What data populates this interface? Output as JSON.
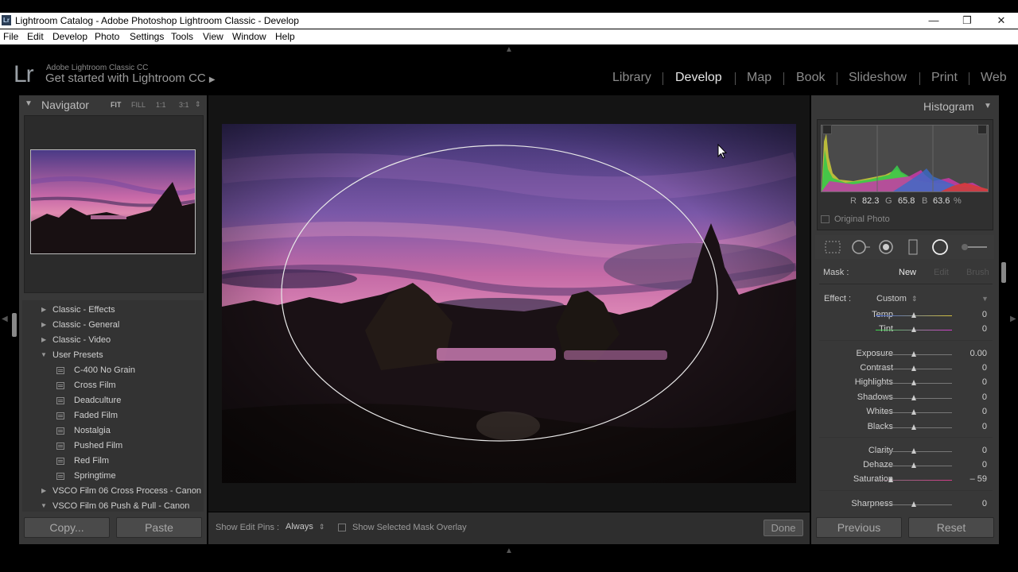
{
  "window": {
    "title": "Lightroom Catalog - Adobe Photoshop Lightroom Classic - Develop",
    "app_icon": "Lr",
    "controls": {
      "minimize": "—",
      "restore": "❐",
      "close": "✕"
    }
  },
  "menu": [
    "File",
    "Edit",
    "Develop",
    "Photo",
    "Settings",
    "Tools",
    "View",
    "Window",
    "Help"
  ],
  "identity": {
    "logo": "Lr",
    "product": "Adobe Lightroom Classic CC",
    "tagline": "Get started with Lightroom CC",
    "tagline_arrow": "▶"
  },
  "modules": [
    "Library",
    "Develop",
    "Map",
    "Book",
    "Slideshow",
    "Print",
    "Web"
  ],
  "active_module": "Develop",
  "navigator": {
    "title": "Navigator",
    "zoom_options": [
      "FIT",
      "FILL",
      "1:1",
      "3:1"
    ],
    "selected_zoom": "FIT",
    "collapse_icon": "▼",
    "zoom_menu_icon": "⇕"
  },
  "presets": {
    "groups": [
      {
        "label": "Classic - Effects",
        "expanded": false
      },
      {
        "label": "Classic - General",
        "expanded": false
      },
      {
        "label": "Classic - Video",
        "expanded": false
      },
      {
        "label": "User Presets",
        "expanded": true
      }
    ],
    "user_presets": [
      "C-400 No Grain",
      "Cross Film",
      "Deadculture",
      "Faded Film",
      "Nostalgia",
      "Pushed Film",
      "Red Film",
      "Springtime"
    ],
    "vsco": [
      {
        "label": "VSCO Film 06 Cross Process - Canon",
        "expanded": false
      },
      {
        "label": "VSCO Film 06 Push & Pull - Canon",
        "expanded": true
      }
    ]
  },
  "left_buttons": {
    "copy": "Copy...",
    "paste": "Paste"
  },
  "toolbar": {
    "show_edit_pins_label": "Show Edit Pins :",
    "show_edit_pins_value": "Always",
    "dropdown_icon": "⇕",
    "mask_overlay_label": "Show Selected Mask Overlay",
    "mask_overlay_checked": false,
    "done": "Done"
  },
  "histogram": {
    "title": "Histogram",
    "collapse_icon": "◀",
    "r_label": "R",
    "r": "82.3",
    "g_label": "G",
    "g": "65.8",
    "b_label": "B",
    "b": "63.6",
    "unit": "%",
    "original_photo": "Original Photo"
  },
  "tools": [
    "crop-overlay-icon",
    "spot-removal-icon",
    "red-eye-icon",
    "graduated-filter-icon",
    "radial-filter-icon",
    "adjustment-brush-icon"
  ],
  "mask": {
    "label": "Mask :",
    "new": "New",
    "edit": "Edit",
    "brush": "Brush"
  },
  "effect": {
    "label": "Effect :",
    "value": "Custom",
    "dropdown_icon": "⇕"
  },
  "sliders": [
    {
      "label": "Temp",
      "value": "0",
      "position": 0.5,
      "gradient": "linear-gradient(90deg,#3b5fd6,#d6c23b)"
    },
    {
      "label": "Tint",
      "value": "0",
      "position": 0.5,
      "gradient": "linear-gradient(90deg,#3bd64a,#d63bd0)"
    },
    {
      "label": "Exposure",
      "value": "0.00",
      "position": 0.5
    },
    {
      "label": "Contrast",
      "value": "0",
      "position": 0.5
    },
    {
      "label": "Highlights",
      "value": "0",
      "position": 0.5
    },
    {
      "label": "Shadows",
      "value": "0",
      "position": 0.5
    },
    {
      "label": "Whites",
      "value": "0",
      "position": 0.5
    },
    {
      "label": "Blacks",
      "value": "0",
      "position": 0.5
    },
    {
      "label": "Clarity",
      "value": "0",
      "position": 0.5
    },
    {
      "label": "Dehaze",
      "value": "0",
      "position": 0.5
    },
    {
      "label": "Saturation",
      "value": "– 59",
      "position": 0.205,
      "gradient": "linear-gradient(90deg,#777,#d63b8a)"
    },
    {
      "label": "Sharpness",
      "value": "0",
      "position": 0.5
    }
  ],
  "right_buttons": {
    "previous": "Previous",
    "reset": "Reset"
  },
  "colors": {
    "panel_bg": "#383838",
    "app_bg": "#000000",
    "active_module": "#e6e6e6",
    "inactive_module": "#8c8c8c",
    "sky_magenta": "#b56aa8",
    "sky_purple": "#5a4a9a"
  }
}
